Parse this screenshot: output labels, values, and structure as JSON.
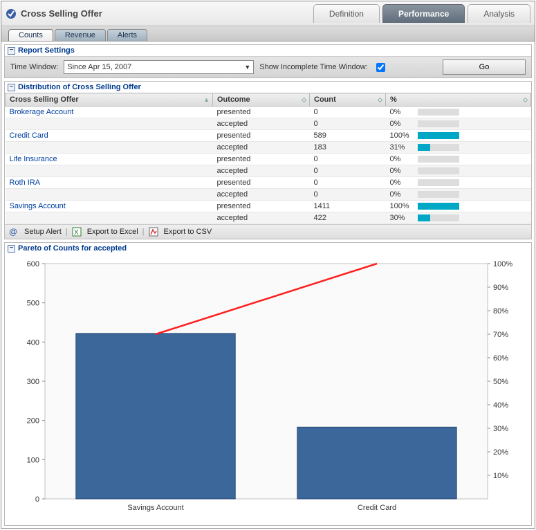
{
  "window": {
    "title": "Cross Selling Offer"
  },
  "main_tabs": [
    {
      "label": "Definition",
      "active": false
    },
    {
      "label": "Performance",
      "active": true
    },
    {
      "label": "Analysis",
      "active": false
    }
  ],
  "sub_tabs": [
    {
      "label": "Counts",
      "active": true
    },
    {
      "label": "Revenue",
      "active": false
    },
    {
      "label": "Alerts",
      "active": false
    }
  ],
  "report_settings": {
    "header": "Report Settings",
    "time_window_label": "Time Window:",
    "time_window_value": "Since Apr 15, 2007",
    "show_incomplete_label": "Show Incomplete Time Window:",
    "show_incomplete_checked": true,
    "go_label": "Go"
  },
  "distribution": {
    "header": "Distribution of Cross Selling Offer",
    "columns": {
      "c0": "Cross Selling Offer",
      "c1": "Outcome",
      "c2": "Count",
      "c3": "%"
    },
    "rows": [
      {
        "offer": "Brokerage Account",
        "outcome": "presented",
        "count": "0",
        "pct_text": "0%",
        "pct_val": 0,
        "show_offer": true,
        "striped": false
      },
      {
        "offer": "",
        "outcome": "accepted",
        "count": "0",
        "pct_text": "0%",
        "pct_val": 0,
        "show_offer": false,
        "striped": true
      },
      {
        "offer": "Credit Card",
        "outcome": "presented",
        "count": "589",
        "pct_text": "100%",
        "pct_val": 100,
        "show_offer": true,
        "striped": false
      },
      {
        "offer": "",
        "outcome": "accepted",
        "count": "183",
        "pct_text": "31%",
        "pct_val": 31,
        "show_offer": false,
        "striped": true
      },
      {
        "offer": "Life Insurance",
        "outcome": "presented",
        "count": "0",
        "pct_text": "0%",
        "pct_val": 0,
        "show_offer": true,
        "striped": false
      },
      {
        "offer": "",
        "outcome": "accepted",
        "count": "0",
        "pct_text": "0%",
        "pct_val": 0,
        "show_offer": false,
        "striped": true
      },
      {
        "offer": "Roth IRA",
        "outcome": "presented",
        "count": "0",
        "pct_text": "0%",
        "pct_val": 0,
        "show_offer": true,
        "striped": false
      },
      {
        "offer": "",
        "outcome": "accepted",
        "count": "0",
        "pct_text": "0%",
        "pct_val": 0,
        "show_offer": false,
        "striped": true
      },
      {
        "offer": "Savings Account",
        "outcome": "presented",
        "count": "1411",
        "pct_text": "100%",
        "pct_val": 100,
        "show_offer": true,
        "striped": false
      },
      {
        "offer": "",
        "outcome": "accepted",
        "count": "422",
        "pct_text": "30%",
        "pct_val": 30,
        "show_offer": false,
        "striped": true
      }
    ]
  },
  "toolbar": {
    "setup_alert": "Setup Alert",
    "export_excel": "Export to Excel",
    "export_csv": "Export to CSV"
  },
  "pareto": {
    "header": "Pareto of Counts for accepted"
  },
  "chart_data": {
    "type": "bar",
    "title": "Pareto of Counts for accepted",
    "categories": [
      "Savings Account",
      "Credit Card"
    ],
    "values": [
      422,
      183
    ],
    "cumulative_pct": [
      70,
      100
    ],
    "ylim": [
      0,
      600
    ],
    "ytick": 100,
    "y2lim": [
      0,
      100
    ],
    "y2tick": 10,
    "y2format": "%",
    "bar_color": "#3b679b",
    "line_color": "#ff1e1e"
  }
}
